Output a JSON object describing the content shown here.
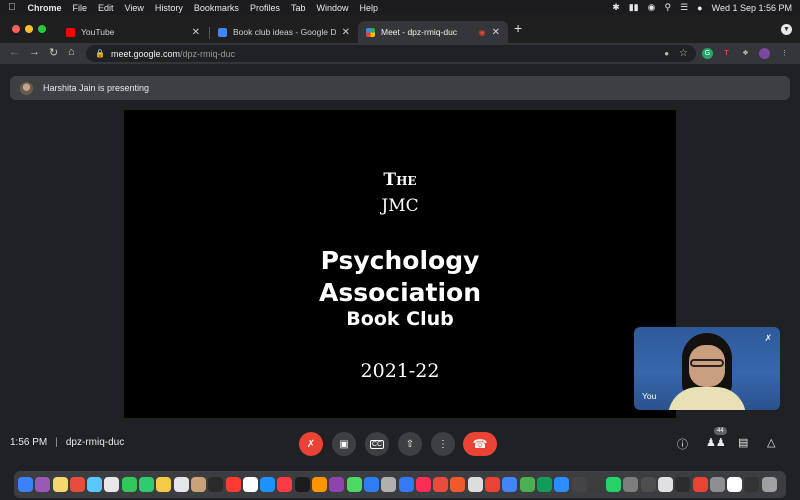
{
  "menubar": {
    "app": "Chrome",
    "items": [
      "File",
      "Edit",
      "View",
      "History",
      "Bookmarks",
      "Profiles",
      "Tab",
      "Window",
      "Help"
    ],
    "datetime": "Wed 1 Sep  1:56 PM"
  },
  "tabs": [
    {
      "title": "YouTube",
      "favicon_color": "#ff0000"
    },
    {
      "title": "Book club ideas - Google Docs",
      "favicon_color": "#4285f4"
    },
    {
      "title": "Meet - dpz-rmiq-duc",
      "favicon_color": "#34a853"
    }
  ],
  "omnibox": {
    "host": "meet.google.com",
    "path": "/dpz-rmiq-duc"
  },
  "meet": {
    "presenting_text": "Harshita Jain is presenting",
    "self_label": "You",
    "time": "1:56 PM",
    "separator": "|",
    "meeting_code": "dpz-rmiq-duc",
    "participants_count": "44"
  },
  "slide": {
    "line_the": "The",
    "line_jmc": "JMC",
    "line_1": "Psychology",
    "line_2": "Association",
    "line_3": "Book Club",
    "year": "2021-22"
  },
  "colors": {
    "meet_bg": "#202124",
    "end_call": "#ea4335",
    "control_bg": "#3c4043"
  },
  "dock_icons": [
    "#3a82f7",
    "#9b59b6",
    "#f5d76e",
    "#e74c3c",
    "#5ac8fa",
    "#e8e8e8",
    "#34c759",
    "#2ecc71",
    "#f7c948",
    "#e5e5ea",
    "#c9a27a",
    "#2b2b2b",
    "#ff3b30",
    "#ffffff",
    "#1e90ff",
    "#fc3c44",
    "#1c1c1e",
    "#ff9500",
    "#8e44ad",
    "#4cd964",
    "#2f7df6",
    "#b0b0b0",
    "#3478f6",
    "#ff2d55",
    "#e74c3c",
    "#f05a28",
    "#dddddd",
    "#ea4335",
    "#4285f4",
    "#4caf50",
    "#0f9d58",
    "#2d8cff",
    "#444444",
    "#3c3c3c",
    "#25d366",
    "#7d7d7d",
    "#4e4e4e",
    "#e0e0e0",
    "#2c2c2e",
    "#ea4335",
    "#8e8e93",
    "#ffffff",
    "#333333",
    "#a0a0a0"
  ]
}
